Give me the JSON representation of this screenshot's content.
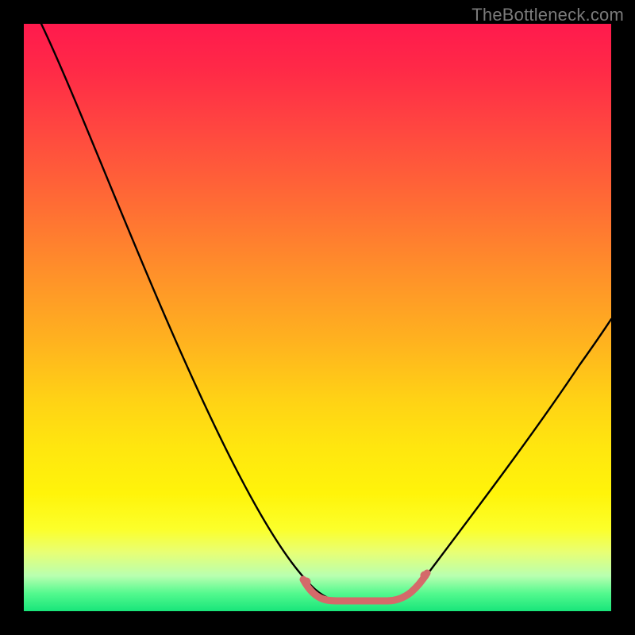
{
  "watermark": "TheBottleneck.com",
  "chart_data": {
    "type": "line",
    "title": "",
    "xlabel": "",
    "ylabel": "",
    "xlim": [
      0,
      100
    ],
    "ylim": [
      0,
      100
    ],
    "gradient_stops": [
      {
        "pct": 0,
        "color": "#ff1a4d"
      },
      {
        "pct": 8,
        "color": "#ff2a47"
      },
      {
        "pct": 18,
        "color": "#ff4740"
      },
      {
        "pct": 30,
        "color": "#ff6a35"
      },
      {
        "pct": 42,
        "color": "#ff8f2a"
      },
      {
        "pct": 54,
        "color": "#ffb21f"
      },
      {
        "pct": 64,
        "color": "#ffd215"
      },
      {
        "pct": 72,
        "color": "#ffe60f"
      },
      {
        "pct": 80,
        "color": "#fff40a"
      },
      {
        "pct": 86,
        "color": "#fcff2a"
      },
      {
        "pct": 90,
        "color": "#e8ff75"
      },
      {
        "pct": 94,
        "color": "#b8ffb0"
      },
      {
        "pct": 97,
        "color": "#53f98e"
      },
      {
        "pct": 100,
        "color": "#18e57a"
      }
    ],
    "series": [
      {
        "name": "bottleneck-curve",
        "color": "#000000",
        "x": [
          3,
          10,
          20,
          30,
          40,
          47,
          52,
          57,
          62,
          68,
          75,
          85,
          95,
          100
        ],
        "y": [
          100,
          86,
          67,
          48,
          30,
          16,
          7,
          2,
          2,
          6,
          15,
          32,
          50,
          60
        ]
      },
      {
        "name": "valley-highlight",
        "color": "#d46a6a",
        "x": [
          48,
          50,
          52,
          54,
          56,
          58,
          60,
          62,
          64,
          66
        ],
        "y": [
          5.5,
          3.5,
          2.5,
          2,
          2,
          2,
          2.2,
          2.8,
          4,
          6
        ]
      }
    ]
  }
}
